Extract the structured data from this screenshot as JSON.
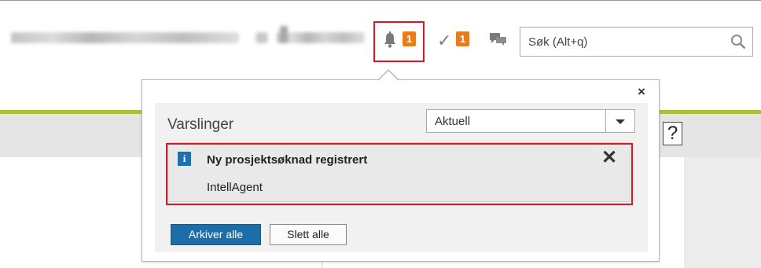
{
  "header": {
    "notification_count": "1",
    "task_count": "1",
    "search": {
      "placeholder": "Søk (Alt+q)"
    },
    "help_label": "?"
  },
  "notifications_popup": {
    "close_label": "×",
    "title": "Varslinger",
    "filter": {
      "selected": "Aktuell"
    },
    "items": [
      {
        "title": "Ny prosjektsøknad registrert",
        "source": "IntellAgent",
        "icon": "info-icon",
        "dismiss_label": "✕"
      }
    ],
    "archive_all_label": "Arkiver alle",
    "delete_all_label": "Slett alle"
  },
  "colors": {
    "badge": "#e87d1e",
    "primary_button": "#1c6ea8",
    "info_icon": "#1f6fb2",
    "accent_line": "#a8c23a",
    "highlight_border": "#e0141e"
  }
}
